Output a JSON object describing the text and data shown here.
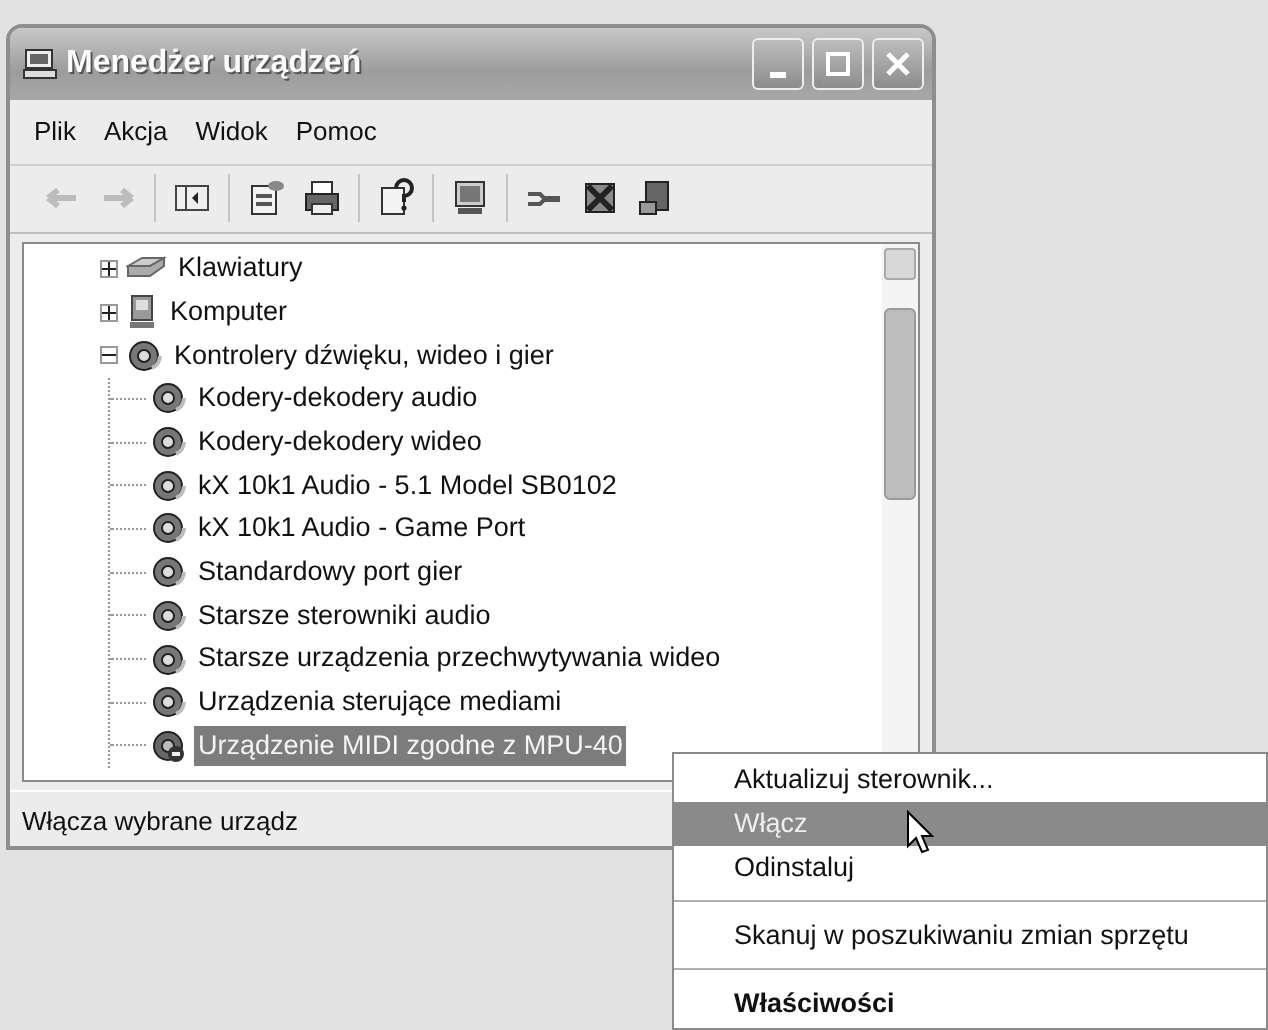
{
  "window": {
    "title": "Menedżer urządzeń"
  },
  "menu": [
    "Plik",
    "Akcja",
    "Widok",
    "Pomoc"
  ],
  "toolbar": {
    "groups": [
      [
        {
          "disabled": true
        },
        {
          "disabled": true
        }
      ],
      [
        {
          "disabled": false
        }
      ],
      [
        {
          "disabled": false
        },
        {
          "disabled": false
        }
      ],
      [
        {
          "disabled": false
        }
      ],
      [
        {
          "disabled": false
        }
      ],
      [
        {
          "disabled": false
        },
        {
          "disabled": false
        },
        {
          "disabled": false
        }
      ]
    ]
  },
  "tree": [
    {
      "label": "Klawiatury",
      "expanded": false,
      "selected": false
    },
    {
      "label": "Komputer",
      "expanded": false,
      "selected": false
    },
    {
      "label": "Kontrolery dźwięku, wideo i gier",
      "expanded": true,
      "selected": false,
      "children": [
        {
          "label": "Kodery-dekodery audio",
          "selected": false,
          "disabled": false
        },
        {
          "label": "Kodery-dekodery wideo",
          "selected": false,
          "disabled": false
        },
        {
          "label": "kX 10k1 Audio - 5.1 Model SB0102",
          "selected": false,
          "disabled": false
        },
        {
          "label": "kX 10k1 Audio - Game Port",
          "selected": false,
          "disabled": false
        },
        {
          "label": "Standardowy port gier",
          "selected": false,
          "disabled": false
        },
        {
          "label": "Starsze sterowniki audio",
          "selected": false,
          "disabled": false
        },
        {
          "label": "Starsze urządzenia przechwytywania wideo",
          "selected": false,
          "disabled": false
        },
        {
          "label": "Urządzenia sterujące mediami",
          "selected": false,
          "disabled": false
        },
        {
          "label": "Urządzenie MIDI zgodne z MPU-40",
          "selected": true,
          "disabled": true
        }
      ]
    }
  ],
  "status_bar": "Włącza wybrane urządz",
  "context_menu": [
    {
      "kind": "item",
      "label": "Aktualizuj sterownik...",
      "selected": false,
      "default": false
    },
    {
      "kind": "item",
      "label": "Włącz",
      "selected": true,
      "default": false
    },
    {
      "kind": "item",
      "label": "Odinstaluj",
      "selected": false,
      "default": false
    },
    {
      "kind": "separator"
    },
    {
      "kind": "item",
      "label": "Skanuj w poszukiwaniu zmian sprzętu",
      "selected": false,
      "default": false
    },
    {
      "kind": "separator"
    },
    {
      "kind": "item",
      "label": "Właściwości",
      "selected": false,
      "default": true
    }
  ]
}
